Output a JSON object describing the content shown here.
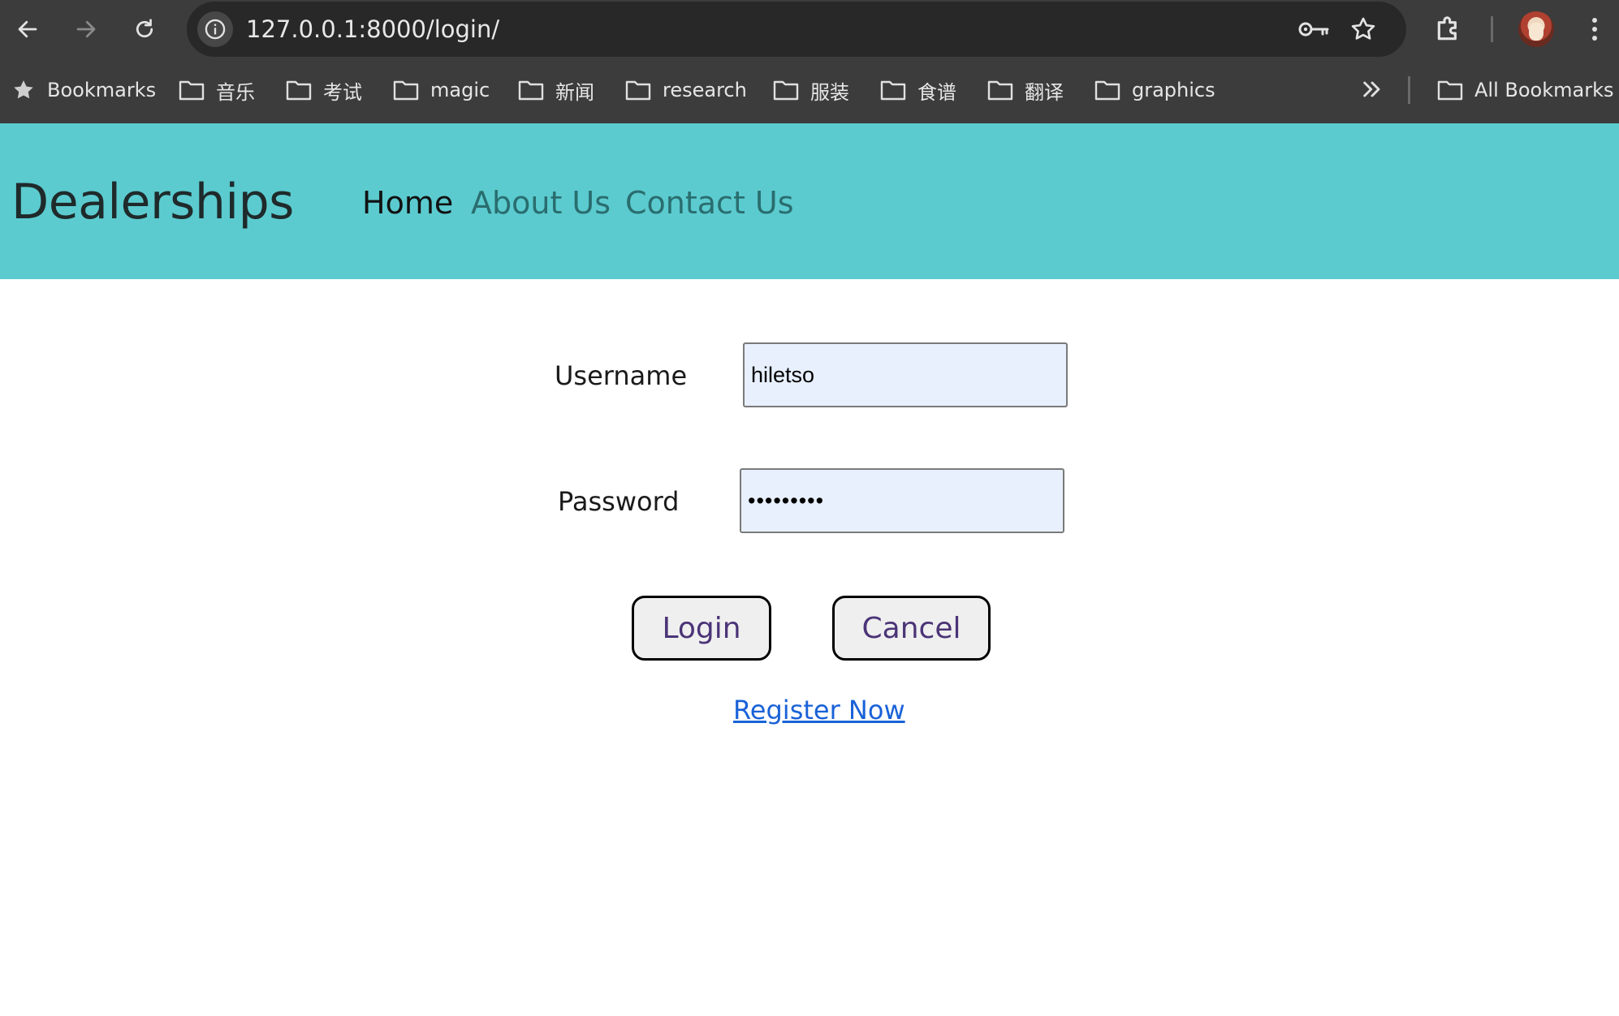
{
  "browser": {
    "url": "127.0.0.1:8000/login/",
    "bookmarks": [
      {
        "label": "Bookmarks",
        "icon": "star-icon"
      },
      {
        "label": "音乐",
        "icon": "folder-icon"
      },
      {
        "label": "考试",
        "icon": "folder-icon"
      },
      {
        "label": "magic",
        "icon": "folder-icon"
      },
      {
        "label": "新闻",
        "icon": "folder-icon"
      },
      {
        "label": "research",
        "icon": "folder-icon"
      },
      {
        "label": "服装",
        "icon": "folder-icon"
      },
      {
        "label": "食谱",
        "icon": "folder-icon"
      },
      {
        "label": "翻译",
        "icon": "folder-icon"
      },
      {
        "label": "graphics",
        "icon": "folder-icon"
      }
    ],
    "all_bookmarks": "All Bookmarks"
  },
  "header": {
    "brand": "Dealerships",
    "nav": {
      "home": "Home",
      "about": "About Us",
      "contact": "Contact Us"
    },
    "background_color": "#5bcbcf"
  },
  "login": {
    "username_label": "Username",
    "username_value": "hiletso",
    "password_label": "Password",
    "password_value": "•••••••••",
    "login_button": "Login",
    "cancel_button": "Cancel",
    "register_link": "Register Now",
    "autofill_color": "#e8f0fe",
    "link_color": "#1a62d8"
  }
}
